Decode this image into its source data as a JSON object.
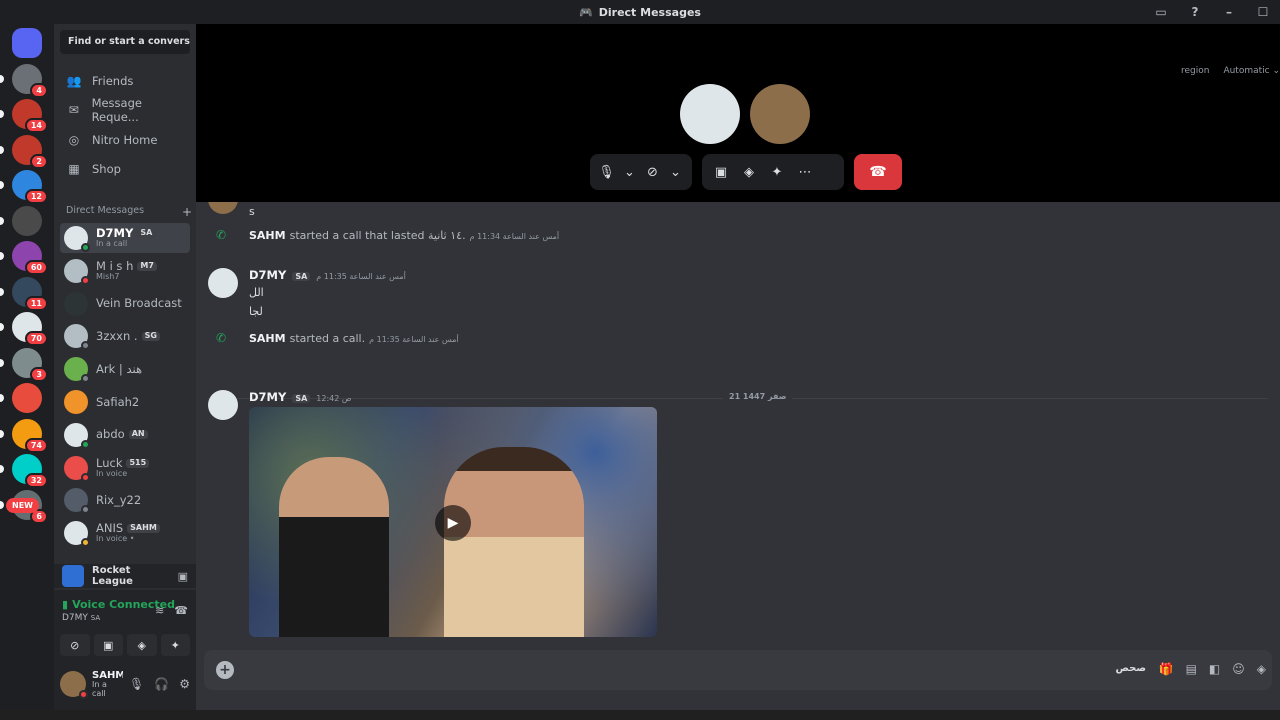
{
  "window": {
    "title": "Direct Messages",
    "controls": [
      "–",
      "☐"
    ]
  },
  "servers": [
    {
      "icon": "discord-home-icon",
      "color": "#5865f2",
      "badge": ""
    },
    {
      "icon": "server-avatar-icon",
      "color": "#6b6f76",
      "badge": "4"
    },
    {
      "icon": "server-icon",
      "color": "#c0392b",
      "badge": "14"
    },
    {
      "icon": "server-icon",
      "color": "#c0392b",
      "badge": "2"
    },
    {
      "icon": "server-icon",
      "color": "#2e86de",
      "badge": "12"
    },
    {
      "icon": "server-icon",
      "color": "#4a4a4a",
      "badge": ""
    },
    {
      "icon": "server-icon",
      "color": "#8e44ad",
      "badge": "60"
    },
    {
      "icon": "server-icon",
      "color": "#34495e",
      "badge": "11"
    },
    {
      "icon": "server-icon",
      "color": "#dfe6e9",
      "badge": "70"
    },
    {
      "icon": "server-icon",
      "color": "#7f8c8d",
      "badge": "3"
    },
    {
      "icon": "server-icon",
      "color": "#e74c3c",
      "badge": ""
    },
    {
      "icon": "server-icon",
      "color": "#f39c12",
      "badge": "74"
    },
    {
      "icon": "server-icon",
      "color": "#00cec9",
      "badge": "32"
    },
    {
      "icon": "server-icon",
      "color": "#636e72",
      "badge": "6"
    }
  ],
  "new_badge": "NEW",
  "sidebar": {
    "search_label": "Find or start a convers...",
    "nav": [
      {
        "label": "Friends",
        "icon": "friends-icon"
      },
      {
        "label": "Message Reque...",
        "icon": "envelope-icon"
      },
      {
        "label": "Nitro Home",
        "icon": "nitro-icon"
      },
      {
        "label": "Shop",
        "icon": "shop-icon"
      }
    ],
    "dm_header": "Direct Messages",
    "dm_add": "+",
    "dms": [
      {
        "name": "D7MY",
        "tag": "SA",
        "sub": "In a call",
        "color": "#dfe6e9",
        "status": "#23a55a",
        "active": true
      },
      {
        "name": "M i s h",
        "tag": "M7",
        "sub": "Mish7",
        "color": "#b2bec3",
        "status": "#f23f43",
        "active": false
      },
      {
        "name": "Vein Broadcast",
        "tag": "",
        "sub": "",
        "color": "#2d3436",
        "status": "",
        "active": false
      },
      {
        "name": "3zxxn .",
        "tag": "SG",
        "sub": "",
        "color": "#b2bec3",
        "status": "#80848e",
        "active": false
      },
      {
        "name": "Ark | هند",
        "tag": "",
        "sub": "",
        "color": "#6ab04c",
        "status": "#80848e",
        "active": false
      },
      {
        "name": "Safiah2",
        "tag": "",
        "sub": "",
        "color": "#f0932b",
        "status": "",
        "active": false
      },
      {
        "name": "abdo",
        "tag": "AN",
        "sub": "",
        "color": "#dfe6e9",
        "status": "#23a55a",
        "active": false
      },
      {
        "name": "Luck",
        "tag": "515",
        "sub": "In voice",
        "color": "#eb4d4b",
        "status": "#f23f43",
        "active": false
      },
      {
        "name": "Rix_y22",
        "tag": "",
        "sub": "",
        "color": "#535c68",
        "status": "#80848e",
        "active": false
      },
      {
        "name": "ANIS",
        "tag": "SAHM",
        "sub": "In voice •",
        "color": "#dfe6e9",
        "status": "#f0b232",
        "active": false
      }
    ],
    "game": {
      "name": "Rocket League"
    },
    "voice": {
      "status": "Voice Connected",
      "channel": "D7MY",
      "channel_tag": "SA"
    },
    "user": {
      "name": "SAHM",
      "status": "In a call"
    }
  },
  "call": {
    "region_label": "region",
    "region_value": "Automatic ⌄",
    "avatars": [
      {
        "color": "#dfe6e9"
      },
      {
        "color": "#8d6e4a"
      }
    ]
  },
  "messages": {
    "top_text": "s",
    "call1_author": "SAHM",
    "call1_text": "started a call that lasted ١٤ ثانية.",
    "call1_time": "أمس عند الساعة 11:34 م",
    "msg1_author": "D7MY",
    "msg1_tag": "SA",
    "msg1_time": "أمس عند الساعة 11:35 م",
    "msg1_line1": "الل",
    "msg1_line2": "لجا",
    "call2_author": "SAHM",
    "call2_text": "started a call.",
    "call2_time": "أمس عند الساعة 11:35 م",
    "date_divider": "21 صفر 1447",
    "msg2_author": "D7MY",
    "msg2_tag": "SA",
    "msg2_time": "12:42 ص"
  },
  "composer": {
    "draft": "صحص"
  }
}
